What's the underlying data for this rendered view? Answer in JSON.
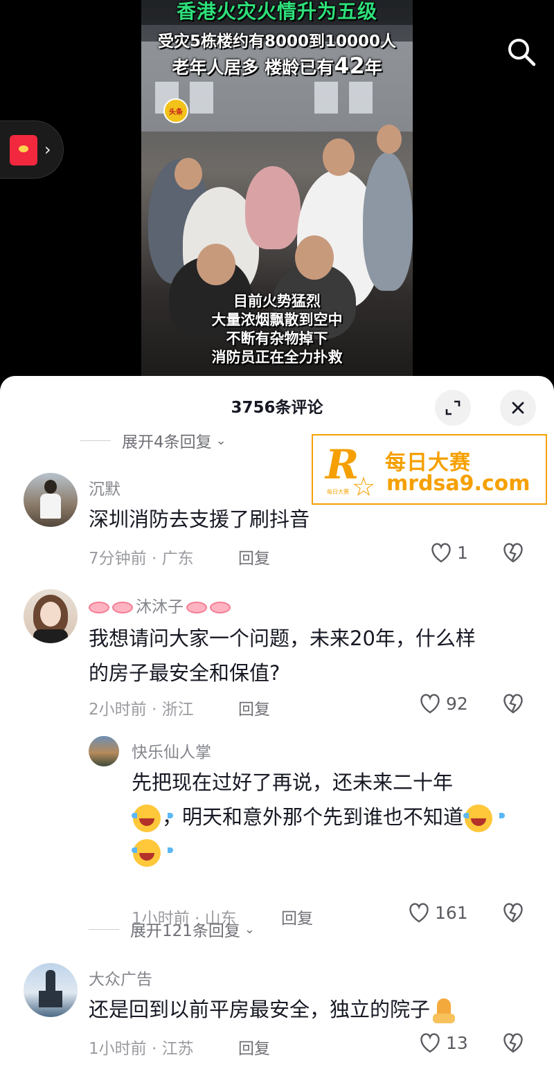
{
  "video": {
    "title": "香港火灾火情升为五级",
    "line1": "受灾5栋楼约有8000到10000人",
    "line2_prefix": "老年人居多 楼龄已有",
    "line2_number": "42",
    "line2_suffix": "年",
    "bottom_lines": [
      "目前火势猛烈",
      "大量浓烟飘散到空中",
      "不断有杂物掉下",
      "消防员正在全力扑救"
    ],
    "badge": "头条"
  },
  "panel": {
    "title": "3756条评论",
    "expand_top": "展开4条回复",
    "expand_mid": "展开121条回复"
  },
  "comments": [
    {
      "name": "沉默",
      "text": "深圳消防去支援了刷抖音",
      "time": "7分钟前 · 广东",
      "reply": "回复",
      "likes": "1"
    },
    {
      "name": "沐沐子",
      "text1": "我想请问大家一个问题，未来20年，什么样",
      "text2": "的房子最安全和保值?",
      "time": "2小时前 · 浙江",
      "reply": "回复",
      "likes": "92"
    },
    {
      "name": "快乐仙人掌",
      "text1": "先把现在过好了再说，还未来二十年",
      "text2": "，明天和意外那个先到谁也不知道",
      "time": "1小时前 · 山东",
      "reply": "回复",
      "likes": "161"
    },
    {
      "name": "大众广告",
      "text": "还是回到以前平房最安全，独立的院子",
      "time": "1小时前 · 江苏",
      "reply": "回复",
      "likes": "13"
    }
  ],
  "ad": {
    "cn": "每日大赛",
    "url": "mrdsa9.com",
    "logo_letter": "R",
    "logo_sub": "每日大赛"
  },
  "icons": [
    "search-icon",
    "red-packet-icon",
    "expand-icon",
    "close-icon",
    "heart-icon",
    "dislike-icon",
    "laugh-cry-emoji",
    "pray-emoji"
  ]
}
